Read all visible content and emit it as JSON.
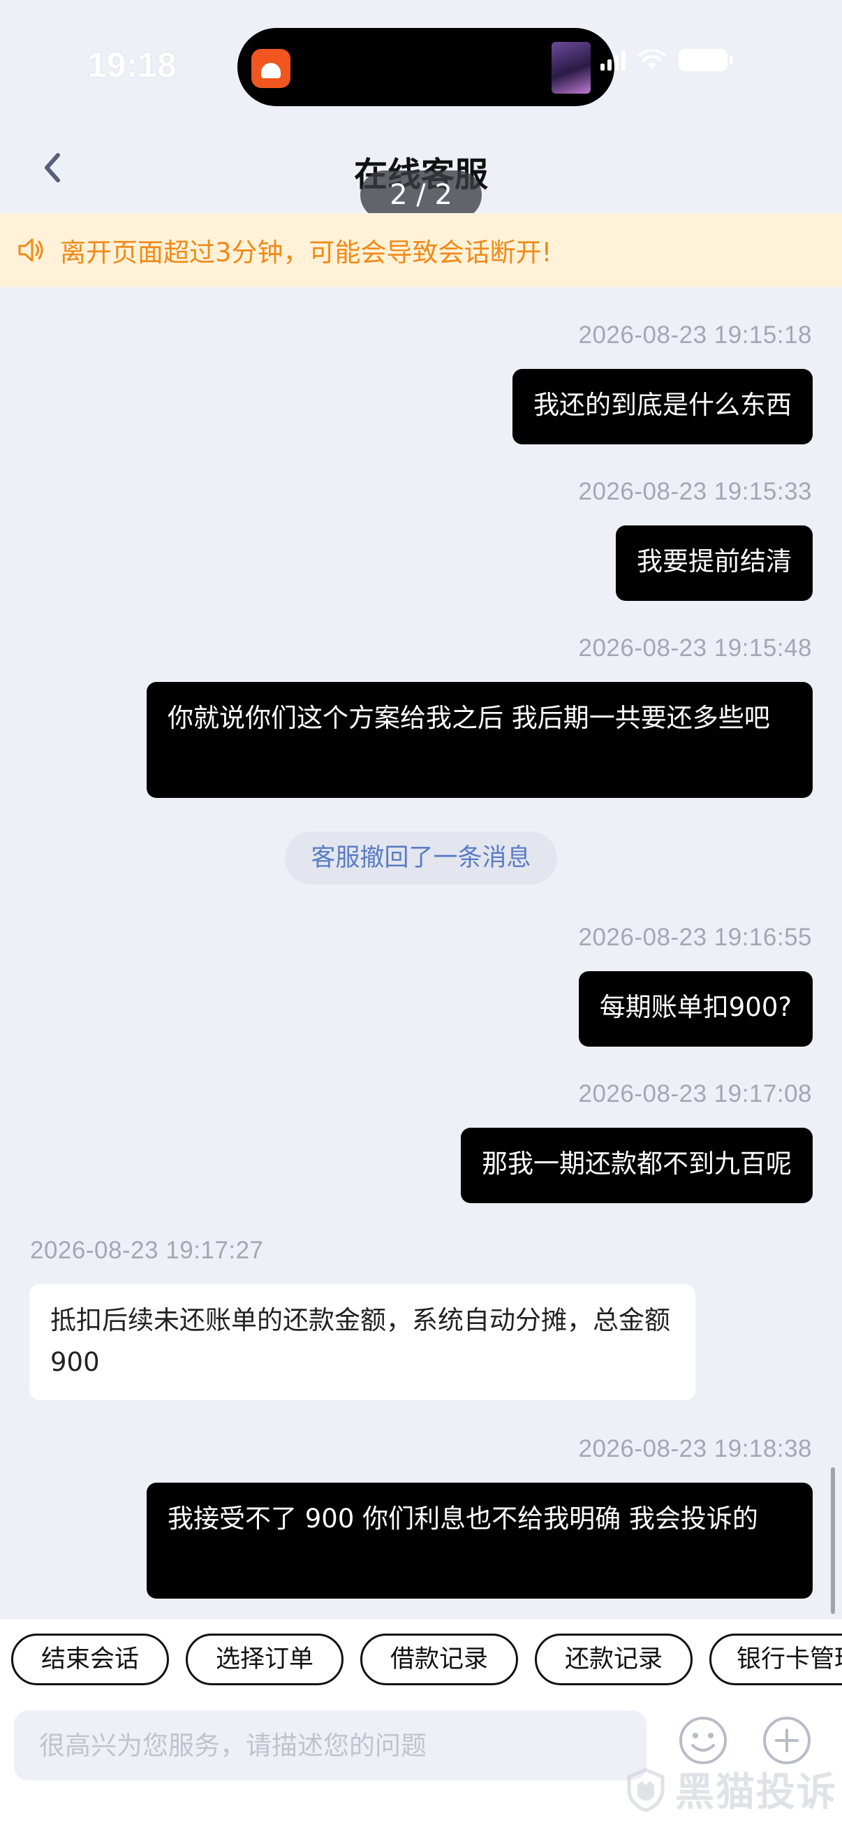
{
  "status_bar": {
    "time": "19:18"
  },
  "header": {
    "title": "在线客服",
    "page_indicator": "2 / 2"
  },
  "notice": {
    "text": "离开页面超过3分钟，可能会导致会话断开!"
  },
  "messages": [
    {
      "timestamp": "2026-08-23 19:15:18",
      "text": "我还的到底是什么东西",
      "direction": "outgoing"
    },
    {
      "timestamp": "2026-08-23 19:15:33",
      "text": "我要提前结清",
      "direction": "outgoing"
    },
    {
      "timestamp": "2026-08-23 19:15:48",
      "text": "你就说你们这个方案给我之后 我后期一共要还多些吧",
      "direction": "outgoing"
    },
    {
      "timestamp": "2026-08-23 19:16:55",
      "text": "每期账单扣900?",
      "direction": "outgoing"
    },
    {
      "timestamp": "2026-08-23 19:17:08",
      "text": "那我一期还款都不到九百呢",
      "direction": "outgoing"
    },
    {
      "timestamp": "2026-08-23 19:17:27",
      "text": "抵扣后续未还账单的还款金额，系统自动分摊，总金额900",
      "direction": "incoming"
    },
    {
      "timestamp": "2026-08-23 19:18:38",
      "text": "我接受不了 900 你们利息也不给我明确 我会投诉的",
      "direction": "outgoing"
    }
  ],
  "system_notice": "客服撤回了一条消息",
  "quick_actions": [
    "结束会话",
    "选择订单",
    "借款记录",
    "还款记录",
    "银行卡管理"
  ],
  "input": {
    "placeholder": "很高兴为您服务，请描述您的问题",
    "value": ""
  },
  "watermark": {
    "text": "黑猫投诉"
  },
  "colors": {
    "outgoing_bubble": "#000000",
    "notice_text": "#F08A17",
    "background": "#EEF0F8"
  }
}
